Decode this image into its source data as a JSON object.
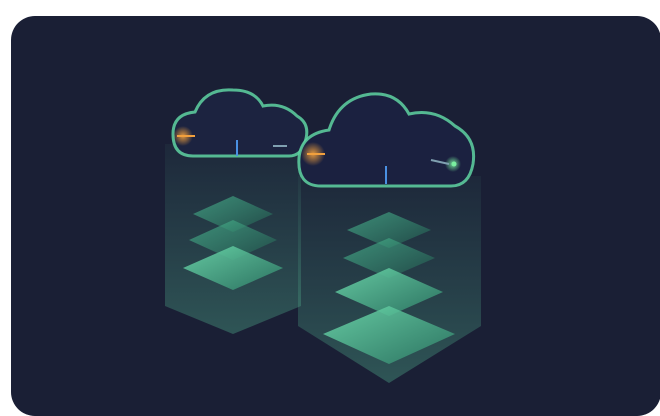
{
  "card": {
    "background": "#1a1f35",
    "accent": "#5fd3a2",
    "secondary_accent": "#4a90e2",
    "warm_accent": "#f2a03d",
    "icons": [
      "cloud-icon",
      "cloud-icon",
      "layers-icon",
      "layers-icon"
    ]
  }
}
